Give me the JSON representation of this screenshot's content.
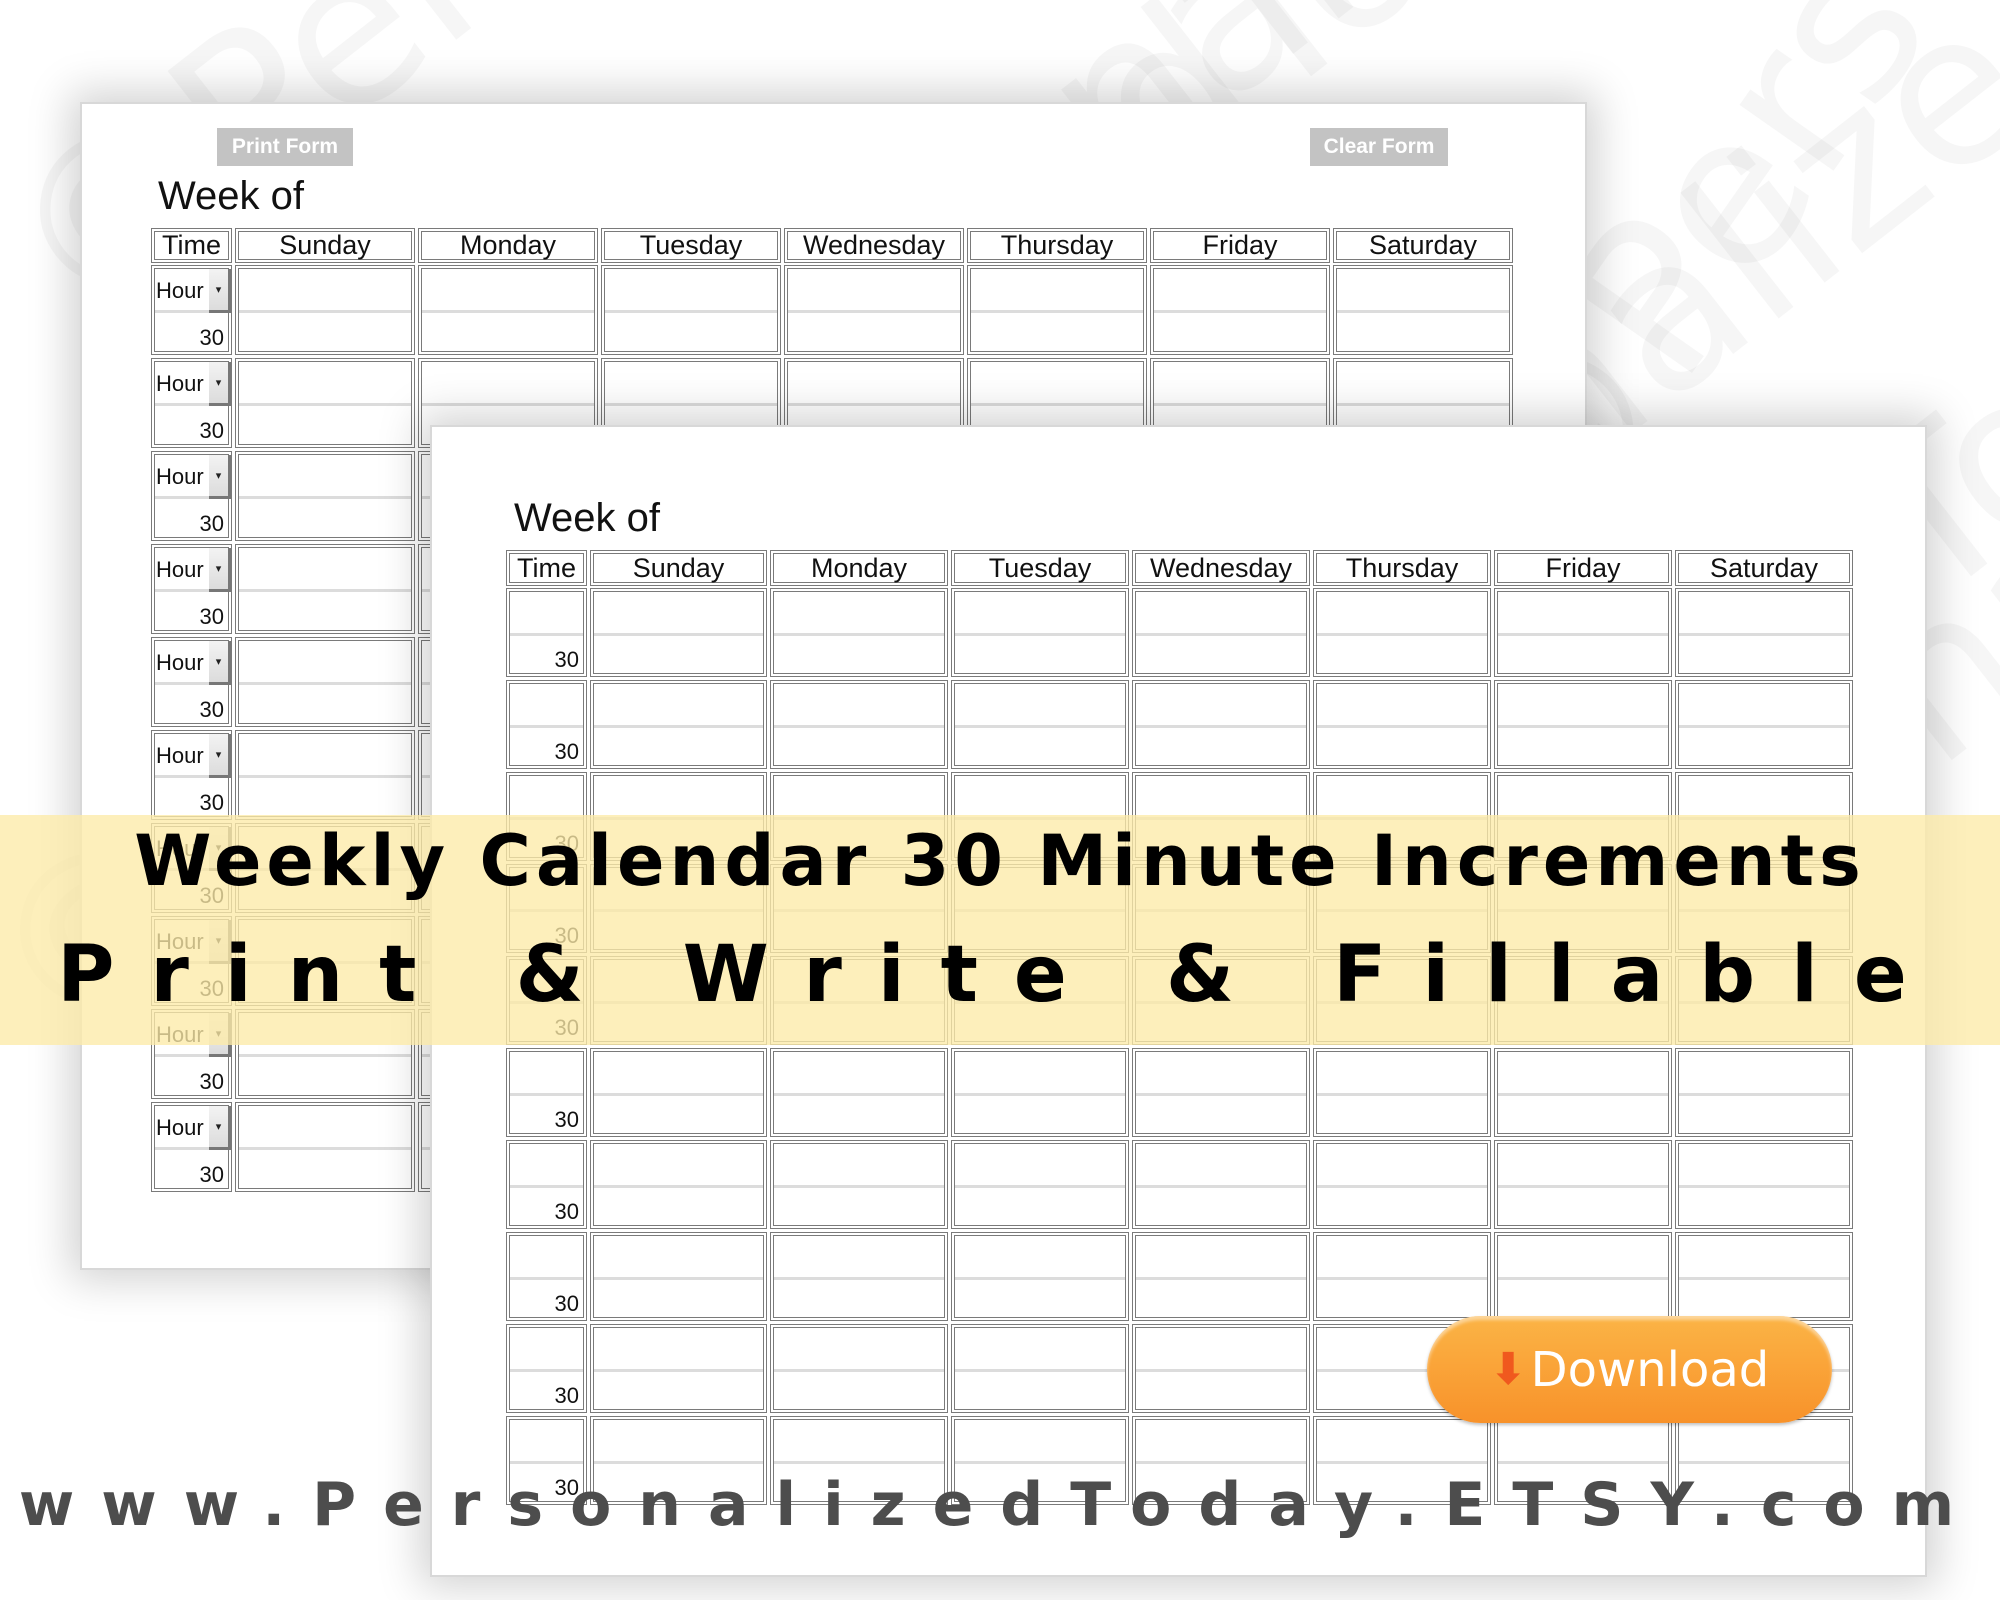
{
  "watermark": {
    "text": "©PersonalizedToday"
  },
  "back_sheet": {
    "print_button": "Print Form",
    "clear_button": "Clear Form",
    "week_of_label": "Week of",
    "headers": [
      "Time",
      "Sunday",
      "Monday",
      "Tuesday",
      "Wednesday",
      "Thursday",
      "Friday",
      "Saturday"
    ],
    "row_count": 10,
    "hour_dropdown": {
      "selected": "Hour"
    },
    "half_hour_label": "30"
  },
  "front_sheet": {
    "week_of_label": "Week of",
    "headers": [
      "Time",
      "Sunday",
      "Monday",
      "Tuesday",
      "Wednesday",
      "Thursday",
      "Friday",
      "Saturday"
    ],
    "row_count": 10,
    "half_hour_label": "30"
  },
  "banner": {
    "title": "Weekly Calendar 30 Minute Increments",
    "subtitle": "Print & Write & Fillable"
  },
  "download_button": {
    "label": "Download",
    "icon": "download-arrow-icon"
  },
  "footer_url": "www.PersonalizedToday.ETSY.com",
  "colors": {
    "banner": "#fcebA8",
    "download_orange": "#f8922a",
    "download_arrow": "#f0591e",
    "url_text": "#4d4d4d",
    "form_button": "#c3c3c3",
    "grid_border": "#7a7a7a"
  }
}
